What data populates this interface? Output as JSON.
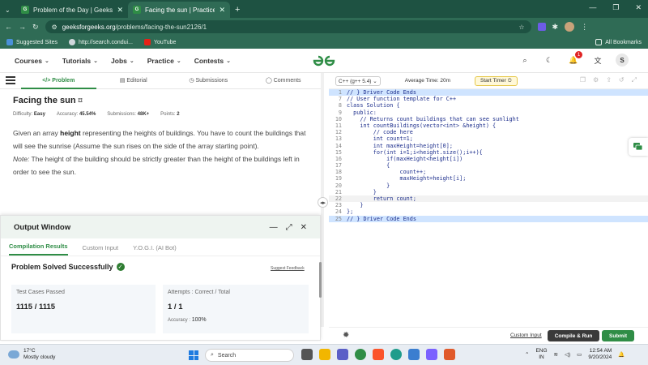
{
  "browser": {
    "tabs": [
      {
        "title": "Problem of the Day | GeeksforG",
        "active": false
      },
      {
        "title": "Facing the sun | Practice | Geek",
        "active": true
      }
    ],
    "url_domain": "geeksforgeeks.org",
    "url_path": "/problems/facing-the-sun2126/1",
    "bookmarks": [
      "Suggested Sites",
      "http://search.condui...",
      "YouTube"
    ],
    "all_bookmarks": "All Bookmarks"
  },
  "nav": {
    "items": [
      "Courses",
      "Tutorials",
      "Jobs",
      "Practice",
      "Contests"
    ],
    "logo": "GG",
    "notification_count": "1",
    "avatar": "S"
  },
  "left_tabs": [
    "Problem",
    "Editorial",
    "Submissions",
    "Comments"
  ],
  "problem": {
    "title": "Facing the sun",
    "difficulty_label": "Difficulty:",
    "difficulty": "Easy",
    "accuracy_label": "Accuracy:",
    "accuracy": "45.54%",
    "submissions_label": "Submissions:",
    "submissions": "48K+",
    "points_label": "Points:",
    "points": "2",
    "desc_pre": "Given an array ",
    "desc_bold": "height",
    "desc_post": " representing the heights of buildings. You have to count the buildings that will see the sunrise (Assume the sun rises on the side of the array starting point).",
    "note_label": "Note:",
    "note_text": " The height of the building should be strictly greater than the height of the buildings left in order to see the sun."
  },
  "output": {
    "title": "Output Window",
    "tabs": [
      "Compilation Results",
      "Custom Input",
      "Y.O.G.I. (AI Bot)"
    ],
    "status": "Problem Solved Successfully",
    "feedback": "Suggest Feedback",
    "tests_label": "Test Cases Passed",
    "tests_value": "1115 / 1115",
    "attempts_label": "Attempts : Correct / Total",
    "attempts_value": "1 / 1",
    "accuracy_label": "Accuracy :",
    "accuracy_value": "100%"
  },
  "editor": {
    "language": "C++ (g++ 5.4)",
    "avg_time": "Average Time: 20m",
    "timer": "Start Timer",
    "lines": [
      {
        "n": "1",
        "t": "// } Driver Code Ends",
        "hl": true,
        "cm": true
      },
      {
        "n": "7",
        "t": "// User function template for C++",
        "cm": true
      },
      {
        "n": "8",
        "t": "class Solution {"
      },
      {
        "n": "9",
        "t": "  public:"
      },
      {
        "n": "10",
        "t": "    // Returns count buildings that can see sunlight",
        "cm": true
      },
      {
        "n": "11",
        "t": "    int countBuildings(vector<int> &height) {"
      },
      {
        "n": "12",
        "t": "        // code here",
        "cm": true
      },
      {
        "n": "13",
        "t": "        int count=1;"
      },
      {
        "n": "14",
        "t": "        int maxHeight=height[0];"
      },
      {
        "n": "15",
        "t": "        for(int i=1;i<height.size();i++){"
      },
      {
        "n": "16",
        "t": "            if(maxHeight<height[i])"
      },
      {
        "n": "17",
        "t": "            {"
      },
      {
        "n": "18",
        "t": "                count++;"
      },
      {
        "n": "19",
        "t": "                maxHeight=height[i];"
      },
      {
        "n": "20",
        "t": "            }"
      },
      {
        "n": "21",
        "t": "        }"
      },
      {
        "n": "22",
        "t": "        return count;",
        "cur": true
      },
      {
        "n": "23",
        "t": "    }"
      },
      {
        "n": "24",
        "t": "};"
      },
      {
        "n": "25",
        "t": "// } Driver Code Ends",
        "hl": true,
        "cm": true
      }
    ],
    "custom_input": "Custom Input",
    "compile_run": "Compile & Run",
    "submit": "Submit"
  },
  "taskbar": {
    "temp": "17°C",
    "weather": "Mostly cloudy",
    "search": "Search",
    "lang1": "ENG",
    "lang2": "IN",
    "time": "12:54 AM",
    "date": "9/20/2024"
  }
}
